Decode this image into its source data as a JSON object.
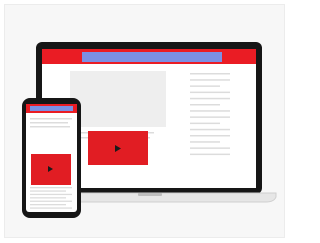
{
  "illustration": {
    "subject": "responsive-video-site-on-laptop-and-phone",
    "colors": {
      "card_background": "#f7f7f7",
      "device_frame": "#161616",
      "screen_background": "#ffffff",
      "header_bar": "#ea1c24",
      "search_bar": "#7b90e4",
      "video_thumbnail": "#eeeeee",
      "video_player": "#e11d23",
      "play_icon": "#1a1a1a",
      "text_line": "#dcdcdc",
      "laptop_base": "#e6e6e6"
    },
    "laptop": {
      "play_icon": "play-icon",
      "sidebar_lines": 14
    },
    "phone": {
      "play_icon": "play-icon",
      "content_lines": 7
    }
  }
}
